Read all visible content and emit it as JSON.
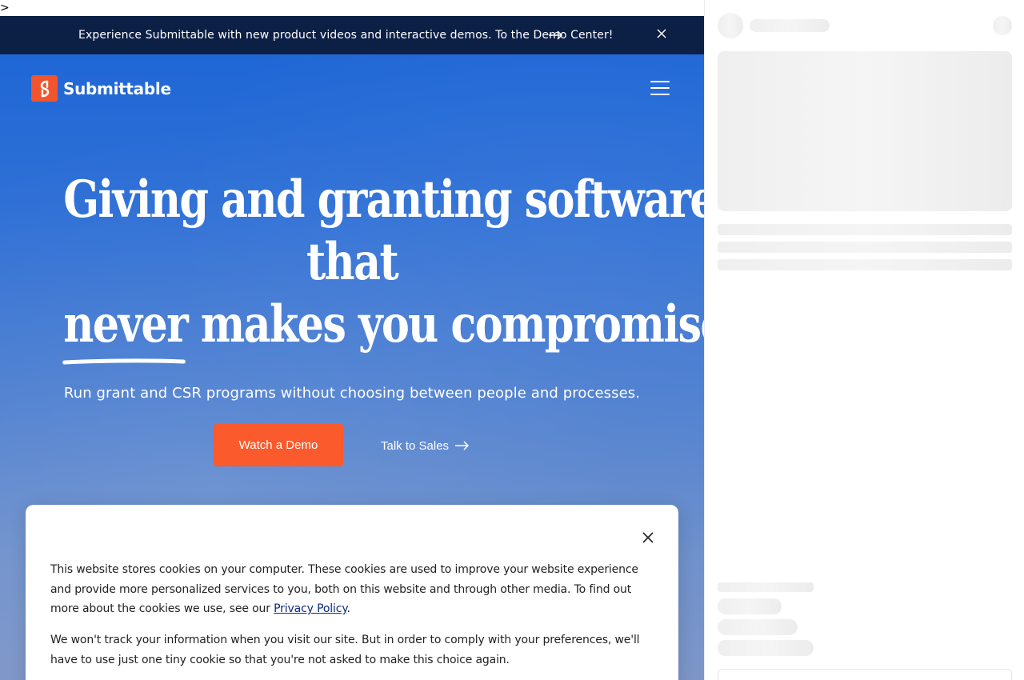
{
  "stray_text": ">",
  "announcement": {
    "text": "Experience Submittable with new product videos and interactive demos. To the Demo Center!",
    "arrow_icon": "long-arrow-right-icon",
    "close_icon": "close-icon"
  },
  "brand": {
    "name": "Submittable",
    "logo_color": "#f2542d"
  },
  "hero": {
    "headline_line1": "Giving and granting software",
    "headline_line2": "that",
    "headline_emphasis": "never",
    "headline_line3_rest": "makes you compromise",
    "subhead": "Run grant and CSR programs without choosing between people and processes.",
    "primary_cta": "Watch a Demo",
    "secondary_cta": "Talk to Sales"
  },
  "cookie": {
    "p1_before_link": "This website stores cookies on your computer. These cookies are used to improve your website experience and provide more personalized services to you, both on this website and through other media. To find out more about the cookies we use, see our ",
    "link_text": "Privacy Policy",
    "p1_after_link": ".",
    "p2": "We won't track your information when you visit our site. But in order to comply with your preferences, we'll have to use just one tiny cookie so that you're not asked to make this choice again."
  },
  "colors": {
    "announcement_bg": "#0c1f45",
    "cta_orange": "#fb5a2d",
    "hero_blue": "#1f67d6"
  }
}
